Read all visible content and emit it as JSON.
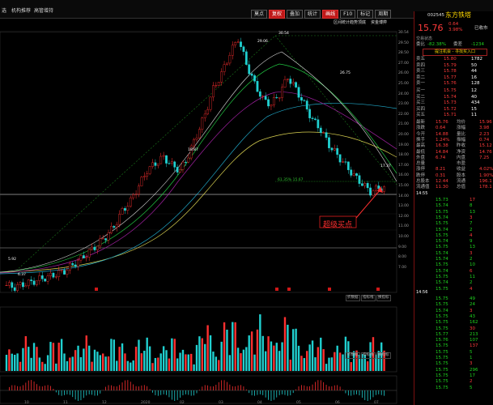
{
  "menu": {
    "items": [
      "选",
      "机构推荐",
      "高管增持"
    ]
  },
  "toolbar": {
    "buttons": [
      "莫点",
      "复权",
      "叠加",
      "统计",
      "画线",
      "F10",
      "标记",
      "周期"
    ],
    "active": [
      "复权",
      "画线"
    ]
  },
  "chart_header": {
    "items": [
      "区间统计",
      "趋势顶底",
      "资金博弈"
    ]
  },
  "stock": {
    "code": "002545",
    "name": "东方铁塔",
    "price": "15.76",
    "change": "0.64",
    "change_pct": "3.98%",
    "status": "已收市"
  },
  "right_panel": {
    "trade_status": "交易状态",
    "wei_bi_label": "委比",
    "wei_bi": "-82.38%",
    "wei_cha_label": "委差",
    "wei_cha": "-1234",
    "tip": "提注机会 - 寻找买入口",
    "sell": [
      {
        "label": "卖五",
        "price": "15.80",
        "vol": "1782"
      },
      {
        "label": "卖四",
        "price": "15.79",
        "vol": "50"
      },
      {
        "label": "卖三",
        "price": "15.78",
        "vol": "44"
      },
      {
        "label": "卖二",
        "price": "15.77",
        "vol": "16"
      },
      {
        "label": "卖一",
        "price": "15.76",
        "vol": "128"
      }
    ],
    "buy": [
      {
        "label": "买一",
        "price": "15.75",
        "vol": "12"
      },
      {
        "label": "买二",
        "price": "15.74",
        "vol": "40"
      },
      {
        "label": "买三",
        "price": "15.73",
        "vol": "434"
      },
      {
        "label": "买四",
        "price": "15.72",
        "vol": "15"
      },
      {
        "label": "买五",
        "price": "15.71",
        "vol": "11"
      }
    ],
    "stats": [
      {
        "l1": "最新",
        "v1": "15.76",
        "l2": "均价",
        "v2": "15.96"
      },
      {
        "l1": "涨跌",
        "v1": "0.64",
        "l2": "涨幅",
        "v2": "3.98"
      },
      {
        "l1": "今开",
        "v1": "14.88",
        "l2": "量比",
        "v2": "2.23"
      },
      {
        "l1": "换手",
        "v1": "1.24%",
        "l2": "振幅",
        "v2": "0.74"
      },
      {
        "l1": "最高",
        "v1": "16.38",
        "l2": "昨收",
        "v2": "15.12"
      },
      {
        "l1": "最低",
        "v1": "14.84",
        "l2": "净资",
        "v2": "14.76"
      },
      {
        "l1": "外盘",
        "v1": "6.74",
        "l2": "内盘",
        "v2": "7.25"
      },
      {
        "l1": "总量",
        "v1": "",
        "l2": "市盈",
        "v2": ""
      },
      {
        "l1": "涨停",
        "v1": "8.21",
        "l2": "收益",
        "v2": "4.02%"
      },
      {
        "l1": "跌停",
        "v1": "0.31",
        "l2": "股本",
        "v2": "1.90%"
      },
      {
        "l1": "总股本",
        "v1": "12.44",
        "l2": "流通",
        "v2": "196.1"
      },
      {
        "l1": "流通值",
        "v1": "11.30",
        "l2": "总值",
        "v2": "178.1"
      }
    ],
    "ticks_time1": "14:55",
    "ticks_time2": "14:56",
    "ticks": [
      [
        "15.73",
        "17"
      ],
      [
        "15.74",
        "8"
      ],
      [
        "15.75",
        "13"
      ],
      [
        "15.74",
        "3"
      ],
      [
        "15.75",
        "7"
      ],
      [
        "15.74",
        "2"
      ],
      [
        "15.75",
        "4"
      ],
      [
        "15.74",
        "9"
      ],
      [
        "15.75",
        "13"
      ],
      [
        "15.74",
        "3"
      ],
      [
        "15.74",
        "2"
      ],
      [
        "15.75",
        "10"
      ],
      [
        "15.74",
        "6"
      ],
      [
        "15.75",
        "11"
      ],
      [
        "15.74",
        "2"
      ],
      [
        "15.75",
        "4"
      ],
      [
        "15.75",
        "49"
      ],
      [
        "15.75",
        "24"
      ],
      [
        "15.74",
        "3"
      ],
      [
        "15.75",
        "43"
      ],
      [
        "15.75",
        "162"
      ],
      [
        "15.75",
        "30"
      ],
      [
        "15.77",
        "213"
      ],
      [
        "15.76",
        "107"
      ],
      [
        "15.75",
        "137"
      ],
      [
        "15.75",
        "5"
      ],
      [
        "15.75",
        "1"
      ],
      [
        "15.75",
        "3"
      ],
      [
        "15.75",
        "296"
      ],
      [
        "15.75",
        "17"
      ],
      [
        "15.75",
        "2"
      ],
      [
        "15.75",
        "5"
      ]
    ]
  },
  "price_axis": [
    "30.54",
    "29.50",
    "28.50",
    "27.00",
    "26.00",
    "25.00",
    "24.00",
    "23.00",
    "22.00",
    "21.00",
    "20.00",
    "19.00",
    "18.00",
    "17.00",
    "16.00",
    "15.00",
    "14.00",
    "13.00",
    "12.00",
    "11.00",
    "10.00",
    "9.00",
    "8.00",
    "7.00"
  ],
  "annotations": {
    "peak": "30.54",
    "label_2906": "29.06",
    "label_2675": "26.75",
    "label_1887": "18.87",
    "label_1737": "17.37",
    "fib": "61.35% 15.67",
    "low_left": "6.37",
    "low_left2": "5.92",
    "super_buy": "超级买点"
  },
  "sub_buttons": [
    "折数据",
    "指标线",
    "换指标"
  ],
  "x_dates": [
    "10",
    "11",
    "12",
    "2020",
    "02",
    "03",
    "04",
    "05",
    "06",
    "07"
  ],
  "chart_data": {
    "type": "candlestick",
    "series": [
      {
        "name": "price",
        "values": [
          6.2,
          6.0,
          6.3,
          6.5,
          6.8,
          7.0,
          7.3,
          7.6,
          8.2,
          8.8,
          9.5,
          10.2,
          11.0,
          12.0,
          13.5,
          14.5,
          16.0,
          17.5,
          18.2,
          18.8,
          18.0,
          17.5,
          19.0,
          21.0,
          23.0,
          25.5,
          27.0,
          29.0,
          30.5,
          28.0,
          26.0,
          24.5,
          24.0,
          25.0,
          26.7,
          25.5,
          24.0,
          22.5,
          21.5,
          20.0,
          19.0,
          18.0,
          17.0,
          16.2,
          15.4,
          15.76
        ]
      }
    ]
  }
}
